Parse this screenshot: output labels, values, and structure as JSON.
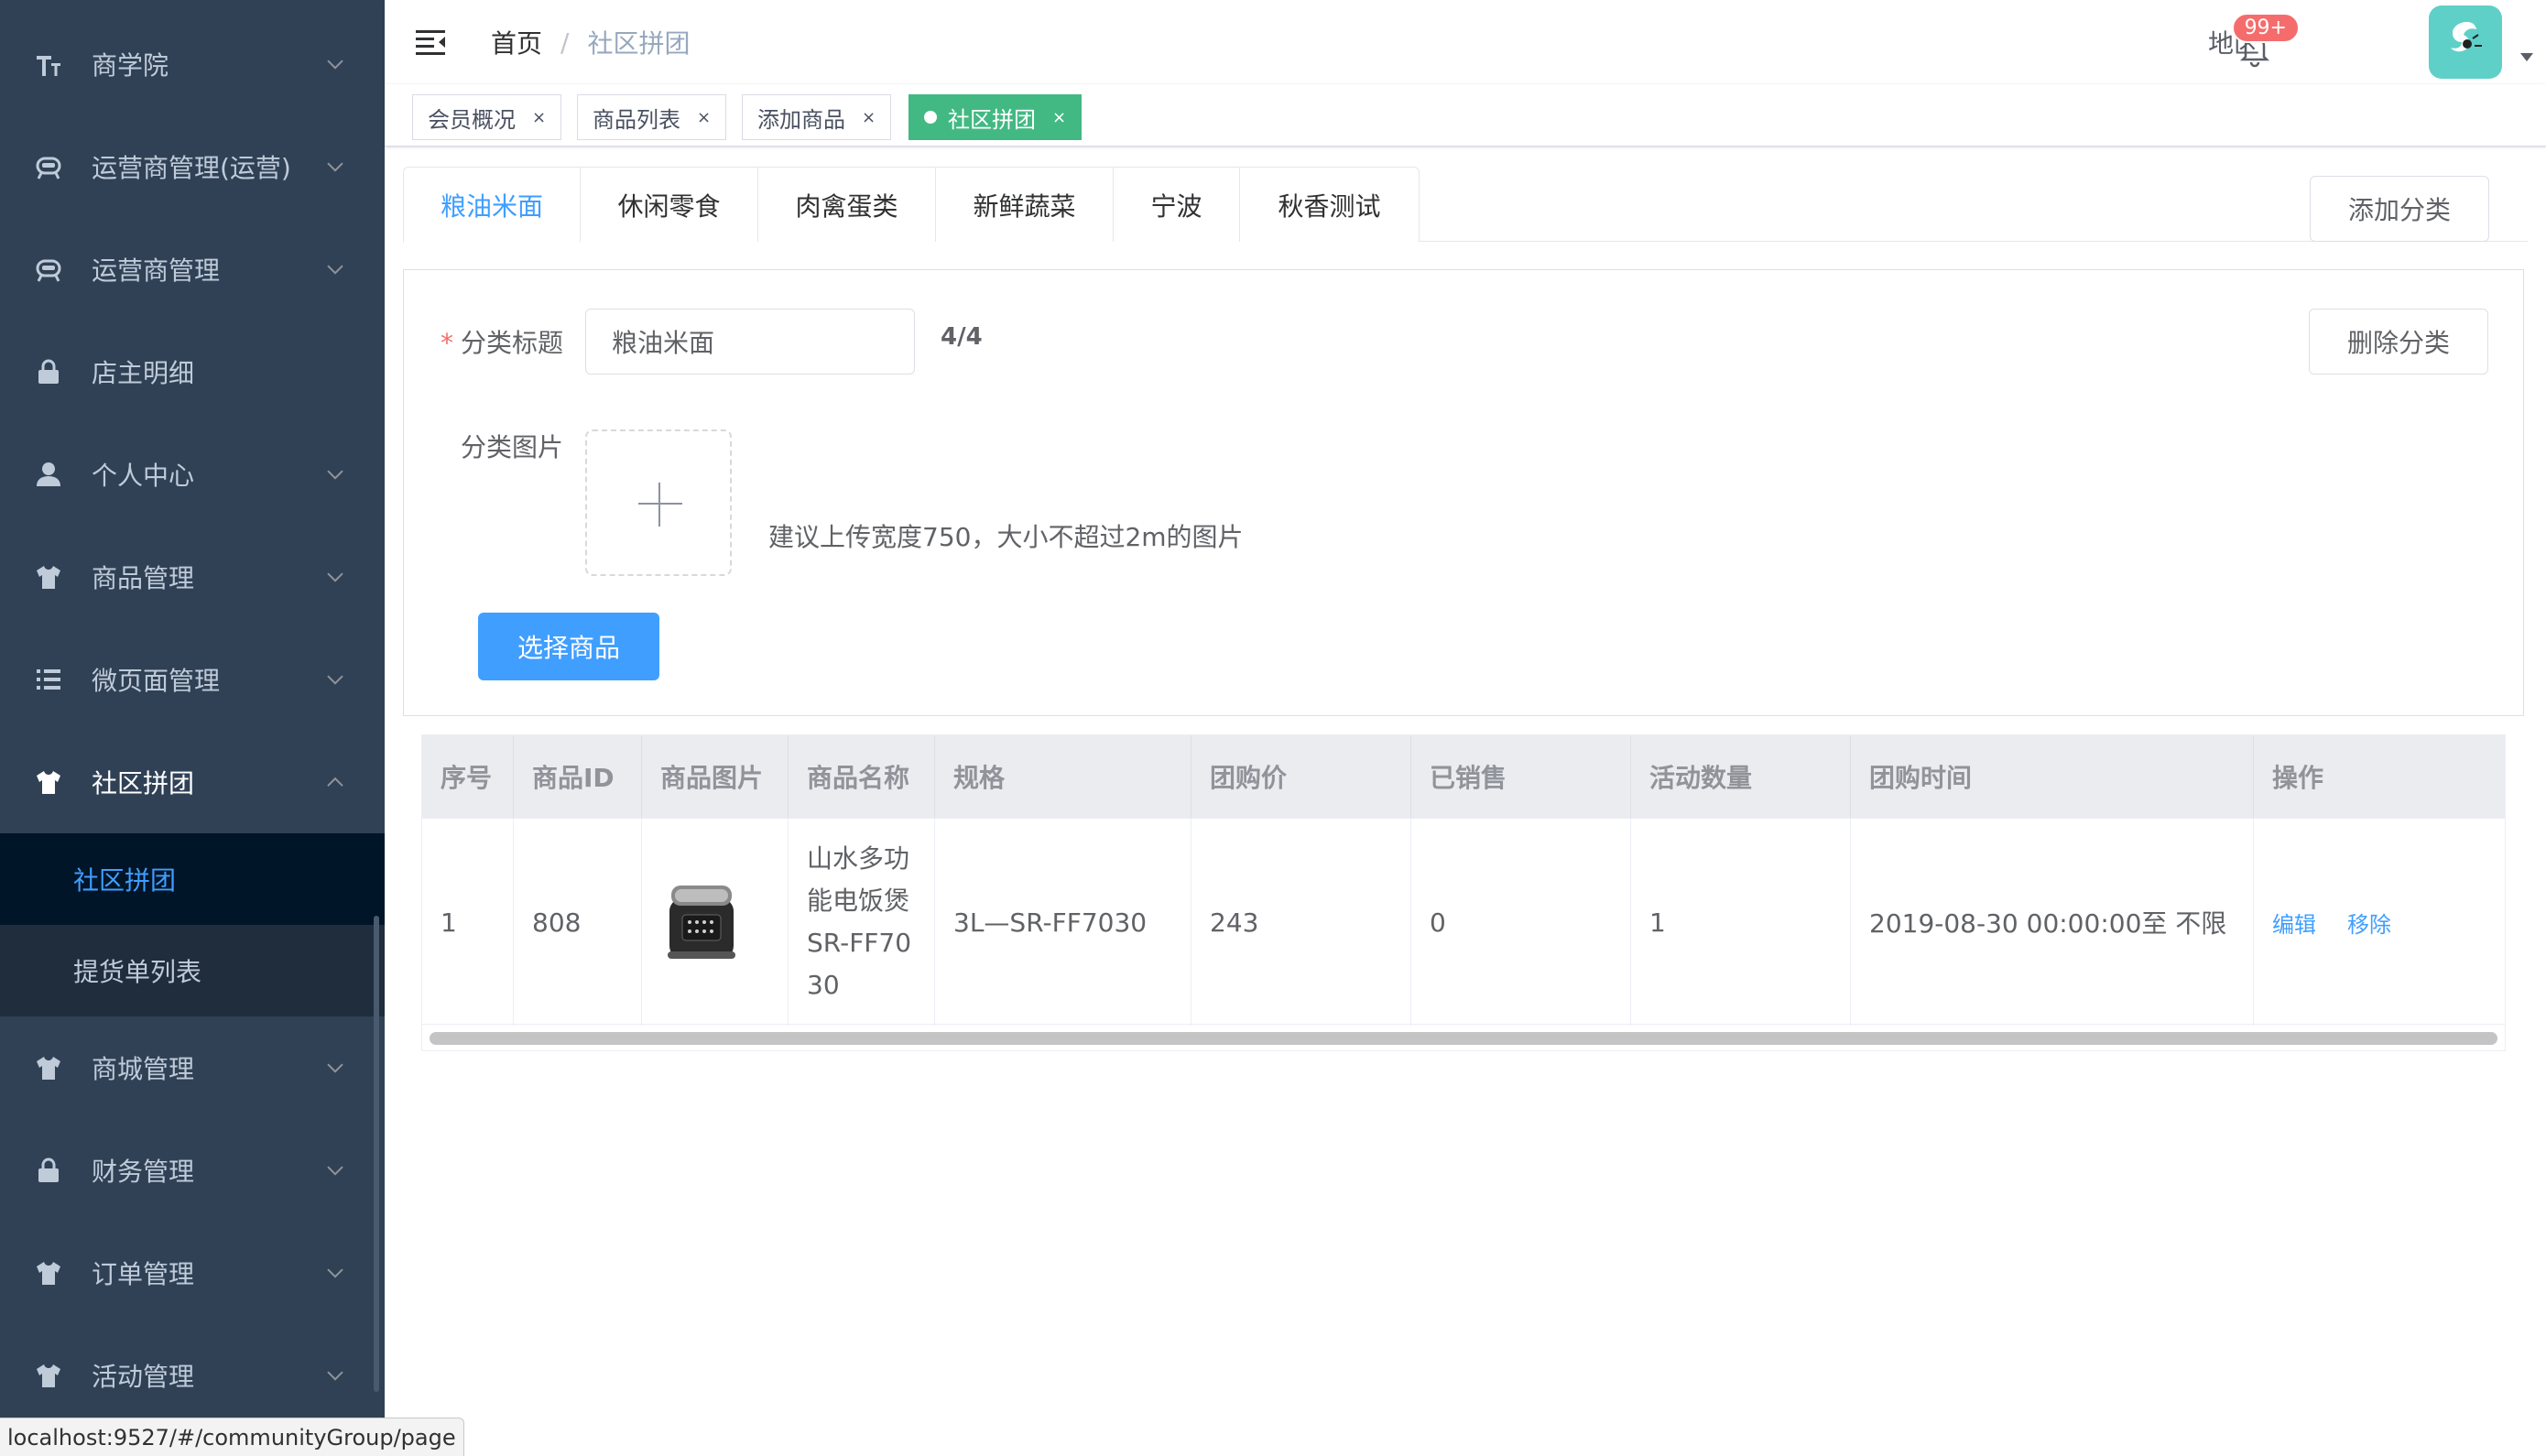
{
  "sidebar": {
    "items": [
      {
        "label": "商学院",
        "icon": "typography-icon",
        "arrow": "down"
      },
      {
        "label": "运营商管理(运营)",
        "icon": "robot-icon",
        "arrow": "down"
      },
      {
        "label": "运营商管理",
        "icon": "robot-icon",
        "arrow": "down"
      },
      {
        "label": "店主明细",
        "icon": "lock-icon",
        "arrow": ""
      },
      {
        "label": "个人中心",
        "icon": "user-icon",
        "arrow": "down"
      },
      {
        "label": "商品管理",
        "icon": "shirt-icon",
        "arrow": "down"
      },
      {
        "label": "微页面管理",
        "icon": "list-icon",
        "arrow": "down"
      },
      {
        "label": "社区拼团",
        "icon": "shirt-icon",
        "arrow": "up"
      },
      {
        "label": "商城管理",
        "icon": "shirt-icon",
        "arrow": "down"
      },
      {
        "label": "财务管理",
        "icon": "lock-icon",
        "arrow": "down"
      },
      {
        "label": "订单管理",
        "icon": "shirt-icon",
        "arrow": "down"
      },
      {
        "label": "活动管理",
        "icon": "shirt-icon",
        "arrow": "down"
      }
    ],
    "submenu": [
      {
        "label": "社区拼团",
        "active": true
      },
      {
        "label": "提货单列表",
        "active": false
      }
    ]
  },
  "navbar": {
    "breadcrumb": {
      "home": "首页",
      "separator": "/",
      "current": "社区拼团"
    },
    "region": "地区",
    "notification_badge": "99+"
  },
  "tags": [
    {
      "label": "会员概况",
      "active": false
    },
    {
      "label": "商品列表",
      "active": false
    },
    {
      "label": "添加商品",
      "active": false
    },
    {
      "label": "社区拼团",
      "active": true
    }
  ],
  "tag_close": "×",
  "category_tabs": [
    {
      "label": "粮油米面",
      "active": true
    },
    {
      "label": "休闲零食",
      "active": false
    },
    {
      "label": "肉禽蛋类",
      "active": false
    },
    {
      "label": "新鲜蔬菜",
      "active": false
    },
    {
      "label": "宁波",
      "active": false
    },
    {
      "label": "秋香测试",
      "active": false
    }
  ],
  "add_category_label": "添加分类",
  "form": {
    "required_mark": "*",
    "title_label": "分类标题",
    "title_value": "粮油米面",
    "title_count": "4/4",
    "delete_label": "删除分类",
    "image_label": "分类图片",
    "upload_hint": "建议上传宽度750，大小不超过2m的图片",
    "select_goods_label": "选择商品"
  },
  "table": {
    "columns": [
      "序号",
      "商品ID",
      "商品图片",
      "商品名称",
      "规格",
      "团购价",
      "已销售",
      "活动数量",
      "团购时间",
      "操作"
    ],
    "rows": [
      {
        "index": "1",
        "goods_id": "808",
        "image": "rice-cooker-image",
        "name": "山水多功能电饭煲SR-FF7030",
        "spec": "3L—SR-FF7030",
        "price": "243",
        "sold": "0",
        "quantity": "1",
        "time": "2019-08-30 00:00:00至 不限",
        "actions": {
          "edit": "编辑",
          "remove": "移除"
        }
      }
    ]
  },
  "status_url": "localhost:9527/#/communityGroup/page",
  "colors": {
    "sidebar_bg": "#304156",
    "sidebar_active_bg": "#001528",
    "submenu_bg": "#1f2d3d",
    "primary": "#409eff",
    "tag_active": "#42b983",
    "badge": "#f56c6c",
    "avatar_bg": "#5fd0c8"
  }
}
